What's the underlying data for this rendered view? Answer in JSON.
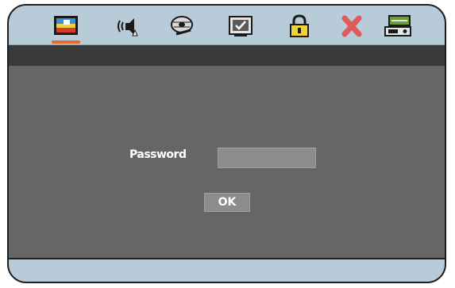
{
  "menu": {
    "items": [
      {
        "icon": "picture-icon",
        "active": true
      },
      {
        "icon": "audio-icon",
        "active": false
      },
      {
        "icon": "disc-icon",
        "active": false
      },
      {
        "icon": "checkbox-tv-icon",
        "active": false
      },
      {
        "icon": "lock-icon",
        "active": false
      },
      {
        "icon": "close-icon",
        "active": false
      },
      {
        "icon": "settings-icon",
        "active": false
      }
    ],
    "active_color": "#e56a2a"
  },
  "dialog": {
    "password_label": "Password",
    "password_value": "",
    "ok_label": "OK"
  },
  "colors": {
    "menubar": "#b8cbd8",
    "subbar": "#3a3a3a",
    "content": "#666666",
    "field": "#8c8c8c"
  }
}
